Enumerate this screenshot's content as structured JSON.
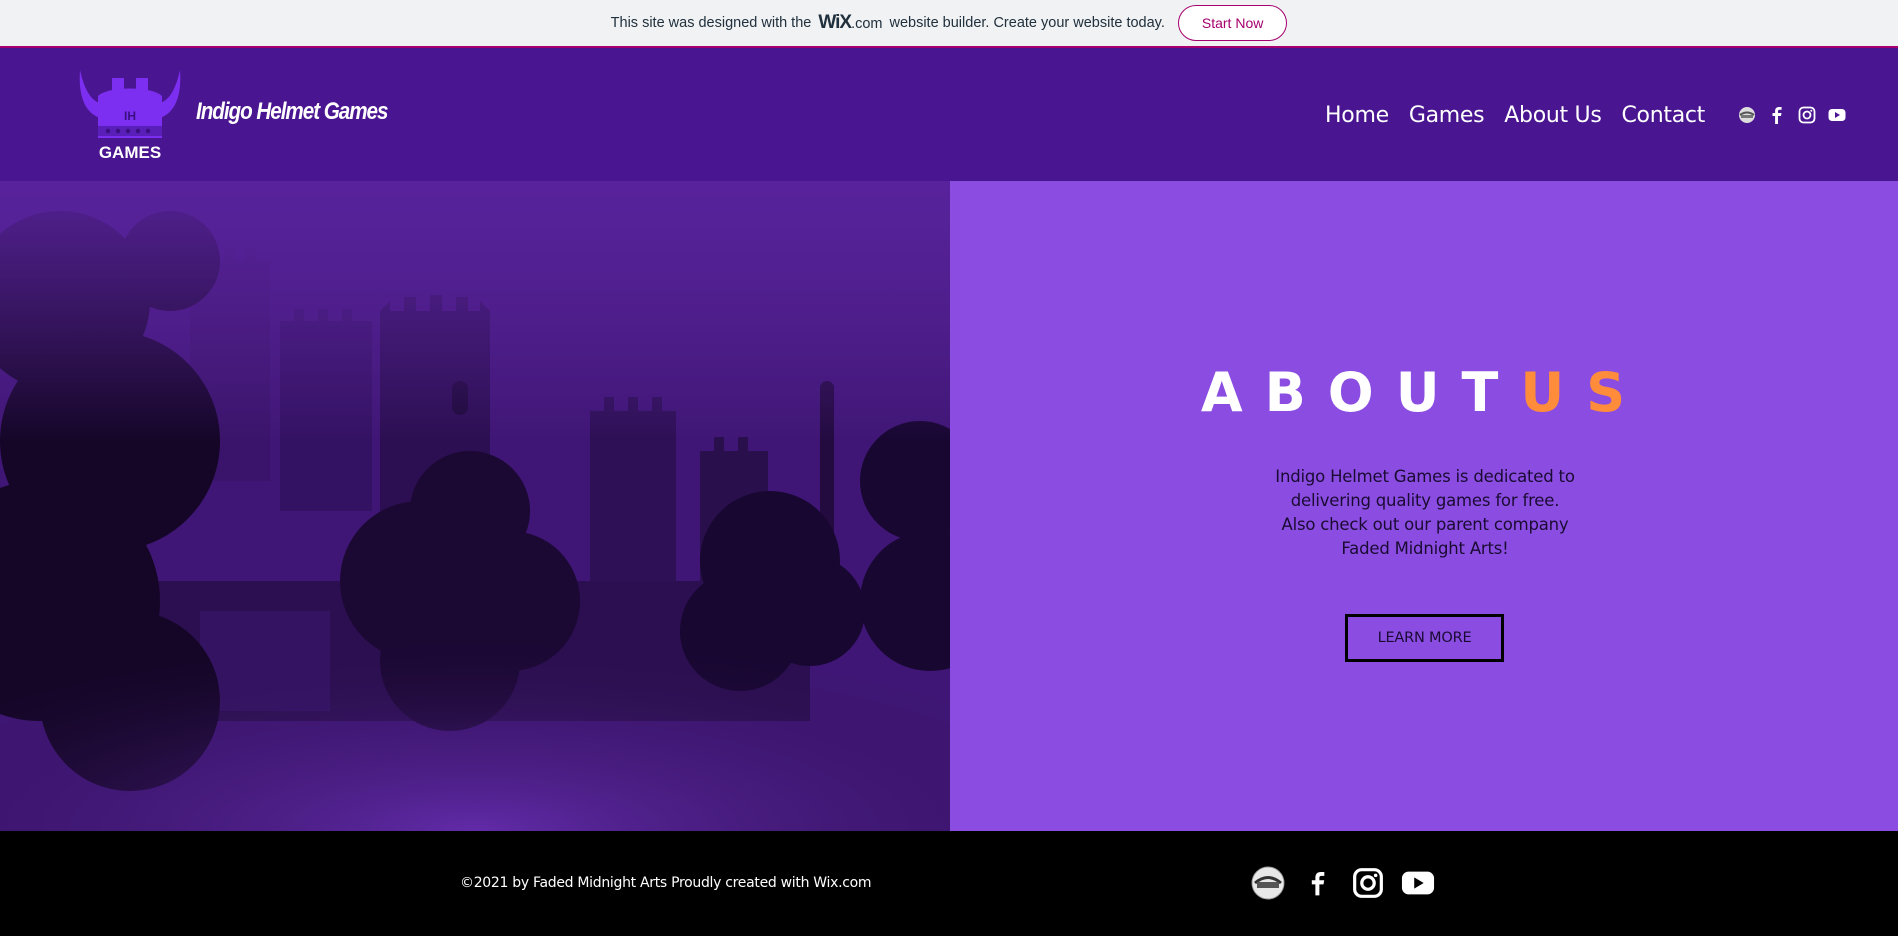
{
  "wix_banner": {
    "text_before": "This site was designed with the",
    "brand": "WiX",
    "brand_suffix": ".com",
    "text_after": "website builder. Create your website today.",
    "button_label": "Start Now"
  },
  "header": {
    "logo_text_top": "IH",
    "logo_text_bottom": "GAMES",
    "site_title": "Indigo Helmet Games",
    "nav": [
      "Home",
      "Games",
      "About Us",
      "Contact"
    ],
    "social_icons": [
      "faded-midnight-icon",
      "facebook-icon",
      "instagram-icon",
      "youtube-icon"
    ]
  },
  "about": {
    "title_white": "ABOUT",
    "title_orange": "US",
    "text": "Indigo Helmet Games is dedicated to delivering quality games for free. Also check out our parent company Faded Midnight Arts!",
    "button_label": "LEARN MORE"
  },
  "footer": {
    "copyright": "©2021 by Faded Midnight Arts Proudly created with Wix.com",
    "social_icons": [
      "faded-midnight-icon",
      "facebook-icon",
      "instagram-icon",
      "youtube-icon"
    ]
  },
  "colors": {
    "header_bg": "#4a1590",
    "panel_bg": "#8b4de1",
    "accent_orange": "#ff8c3a",
    "wix_accent": "#a5006e"
  }
}
